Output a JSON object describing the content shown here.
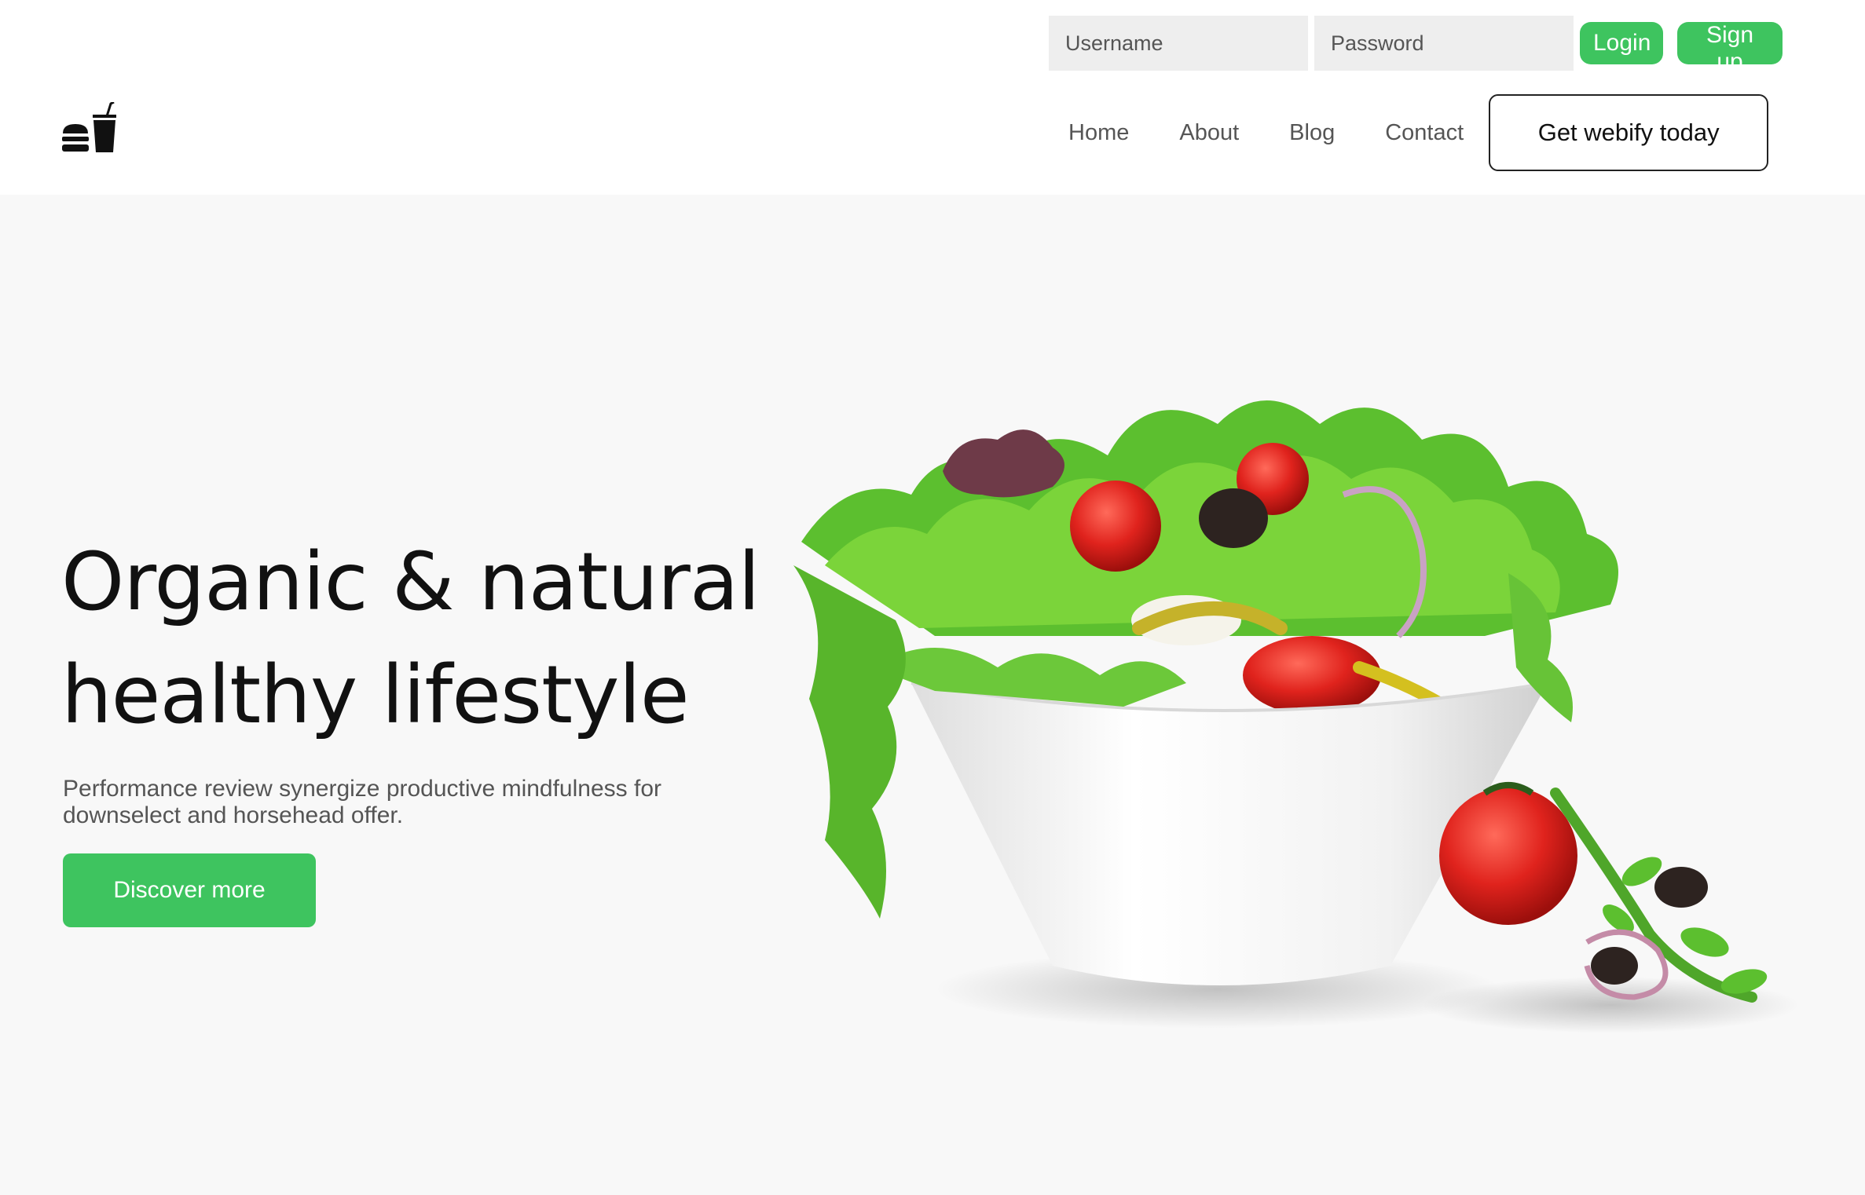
{
  "auth": {
    "username_placeholder": "Username",
    "password_placeholder": "Password",
    "login_label": "Login",
    "signup_label": "Sign up"
  },
  "nav": {
    "items": [
      {
        "label": "Home"
      },
      {
        "label": "About"
      },
      {
        "label": "Blog"
      },
      {
        "label": "Contact"
      }
    ],
    "cta_label": "Get webify today"
  },
  "hero": {
    "title_line1": "Organic & natural",
    "title_line2": "healthy lifestyle",
    "subtitle": "Performance review synergize productive mindfulness for downselect and horsehead offer.",
    "button_label": "Discover more"
  },
  "icons": {
    "logo": "burger-and-drink-icon",
    "hero_image": "salad-bowl-illustration"
  },
  "colors": {
    "accent": "#3ec45f",
    "page_background": "#f8f8f8",
    "header_background": "#ffffff",
    "input_background": "#eeeeee"
  }
}
